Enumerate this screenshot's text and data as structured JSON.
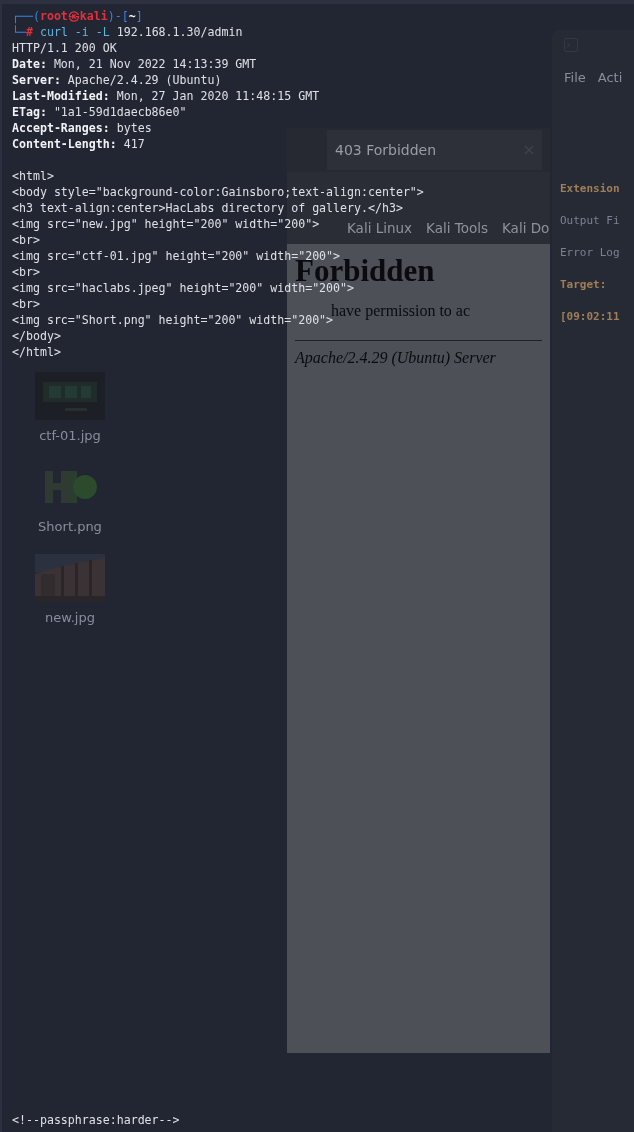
{
  "desktop": {
    "icons": [
      {
        "label": "ctf-01.jpg",
        "kind": "picture"
      },
      {
        "label": "Short.png",
        "kind": "logo"
      },
      {
        "label": "new.jpg",
        "kind": "picture"
      }
    ]
  },
  "browser": {
    "tab": {
      "title": "403 Forbidden"
    },
    "bookmarks": [
      "Kali Linux",
      "Kali Tools",
      "Kali Do"
    ],
    "page": {
      "heading": "Forbidden",
      "message": "have permission to ac",
      "footer": "Apache/2.4.29 (Ubuntu) Server"
    }
  },
  "back_terminal": {
    "menu": [
      "File",
      "Acti"
    ],
    "lines": [
      {
        "text": "Extension",
        "bold": true
      },
      {
        "text": "Output Fi",
        "bold": false
      },
      {
        "text": "Error Log",
        "bold": false
      },
      {
        "text": "Target:",
        "bold": true
      },
      {
        "text": "[09:02:11",
        "bold": true
      }
    ]
  },
  "terminal": {
    "prompt": {
      "corner_top": "┌──(",
      "user": "root",
      "at": "㉿",
      "host": "kali",
      "dir_open": ")-[",
      "dir": "~",
      "dir_close": "]",
      "corner_bottom": "└─",
      "symbol": "#"
    },
    "command": "curl -i -L",
    "argument": "192.168.1.30/admin",
    "status_line": "HTTP/1.1 200 OK",
    "headers": [
      {
        "name": "Date:",
        "value": "Mon, 21 Nov 2022 14:13:39 GMT"
      },
      {
        "name": "Server:",
        "value": "Apache/2.4.29 (Ubuntu)"
      },
      {
        "name": "Last-Modified:",
        "value": "Mon, 27 Jan 2020 11:48:15 GMT"
      },
      {
        "name": "ETag:",
        "value": "\"1a1-59d1daecb86e0\""
      },
      {
        "name": "Accept-Ranges:",
        "value": "bytes"
      },
      {
        "name": "Content-Length:",
        "value": "417"
      }
    ],
    "body": [
      "<html>",
      "<body style=\"background-color:Gainsboro;text-align:center\">",
      "<h3 text-align:center>HacLabs directory of gallery.</h3>",
      "<img src=\"new.jpg\" height=\"200\" width=\"200\">",
      "<br>",
      "<img src=\"ctf-01.jpg\" height=\"200\" width=\"200\">",
      "<br>",
      "<img src=\"haclabs.jpeg\" height=\"200\" width=\"200\">",
      "<br>",
      "<img src=\"Short.png\" height=\"200\" width=\"200\">",
      "</body>",
      "</html>"
    ],
    "footer_line": "<!--passphrase:harder-->"
  }
}
